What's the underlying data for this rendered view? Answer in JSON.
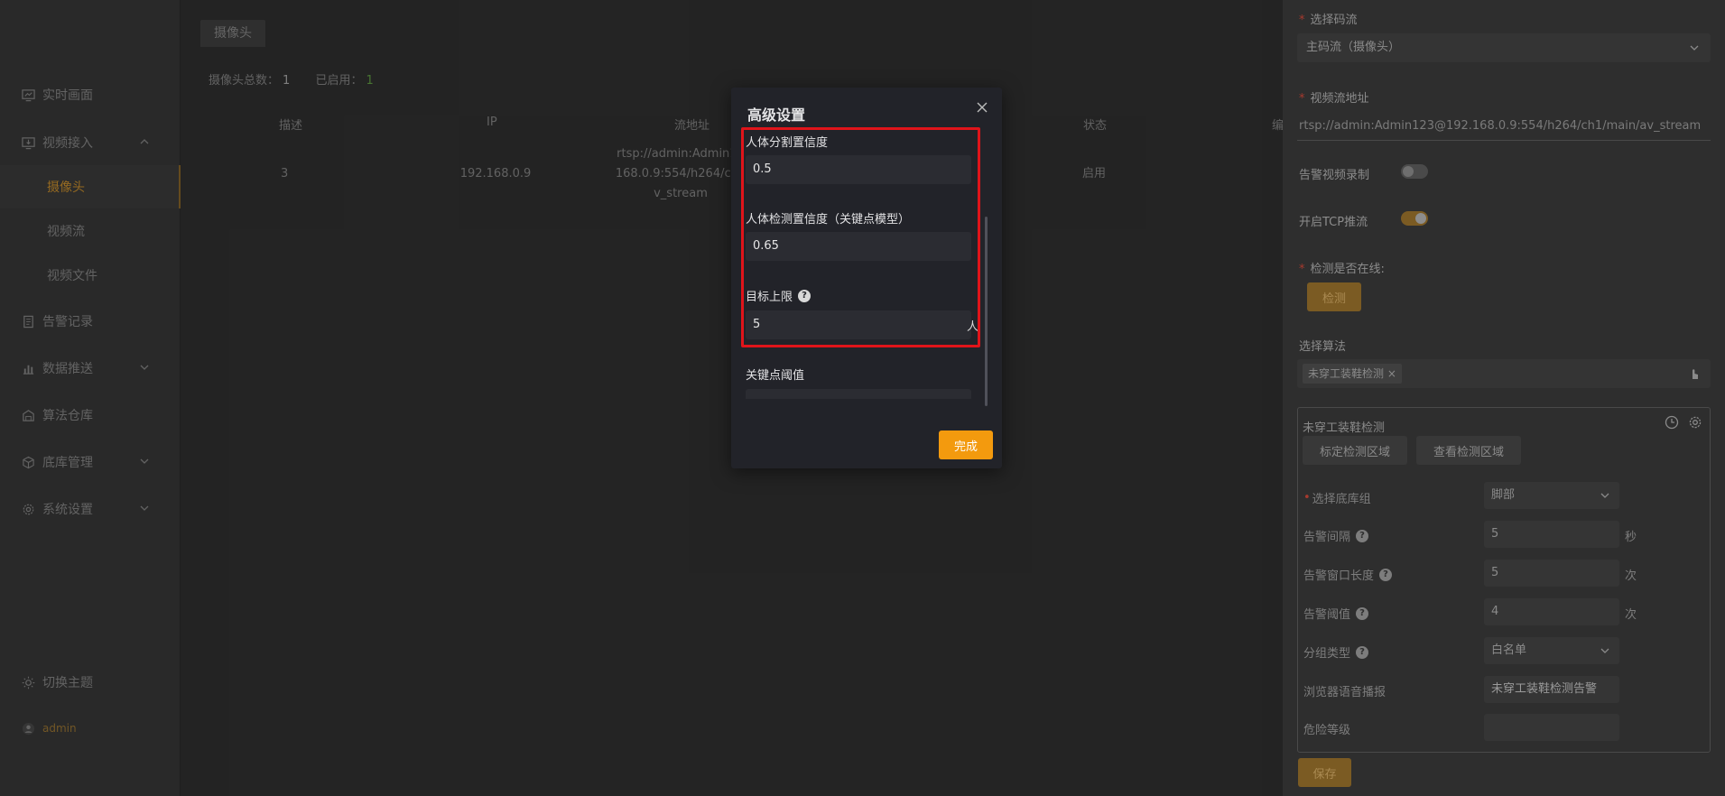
{
  "sidebar": {
    "items": [
      {
        "label": "实时画面",
        "icon": "monitor-icon"
      },
      {
        "label": "视频接入",
        "icon": "video-input-icon"
      },
      {
        "label": "摄像头"
      },
      {
        "label": "视频流"
      },
      {
        "label": "视频文件"
      },
      {
        "label": "告警记录",
        "icon": "document-icon"
      },
      {
        "label": "数据推送",
        "icon": "chart-icon"
      },
      {
        "label": "算法仓库",
        "icon": "warehouse-icon"
      },
      {
        "label": "底库管理",
        "icon": "cube-icon"
      },
      {
        "label": "系统设置",
        "icon": "gear-icon"
      }
    ],
    "theme_label": "切换主题",
    "user": "admin"
  },
  "main": {
    "tab": "摄像头",
    "counts": {
      "total_label": "摄像头总数：",
      "total": "1",
      "enabled_label": "已启用：",
      "enabled": "1"
    },
    "table": {
      "headers": [
        "描述",
        "IP",
        "流地址",
        "状态",
        "编"
      ],
      "row": {
        "desc": "3",
        "ip": "192.168.0.9",
        "url_lines": [
          "rtsp://admin:Admin12",
          "168.0.9:554/h264/ch1",
          "v_stream"
        ],
        "status": "启用"
      }
    }
  },
  "modal": {
    "title": "高级设置",
    "fields": [
      {
        "label": "人体分割置信度",
        "value": "0.5"
      },
      {
        "label": "人体检测置信度（关键点模型）",
        "value": "0.65"
      },
      {
        "label": "目标上限",
        "value": "5",
        "unit": "人"
      },
      {
        "label": "关键点阈值",
        "value": ""
      }
    ],
    "done_label": "完成",
    "highlight_color": "#e0141a"
  },
  "panel": {
    "stream_label": "选择码流",
    "stream_value": "主码流（摄像头）",
    "url_label": "视频流地址",
    "url_value": "rtsp://admin:Admin123@192.168.0.9:554/h264/ch1/main/av_stream",
    "record_label": "告警视频录制",
    "record_on": false,
    "tcp_label": "开启TCP推流",
    "tcp_on": true,
    "online_label": "检测是否在线:",
    "detect_btn": "检测",
    "algo_label": "选择算法",
    "algo_tag": "未穿工装鞋检测",
    "card": {
      "title": "未穿工装鞋检测",
      "btn_mark": "标定检测区域",
      "btn_view": "查看检测区域",
      "rows": [
        {
          "label": "选择底库组",
          "value": "脚部",
          "select": true
        },
        {
          "label": "告警间隔",
          "value": "5",
          "unit": "秒",
          "help": true
        },
        {
          "label": "告警窗口长度",
          "value": "5",
          "unit": "次",
          "help": true
        },
        {
          "label": "告警阈值",
          "value": "4",
          "unit": "次",
          "help": true
        },
        {
          "label": "分组类型",
          "value": "白名单",
          "select": true,
          "help": true
        },
        {
          "label": "浏览器语音播报",
          "value": "未穿工装鞋检测告警"
        },
        {
          "label": "危险等级",
          "value": ""
        }
      ]
    },
    "save_label": "保存",
    "accent": "#7b5b23"
  }
}
